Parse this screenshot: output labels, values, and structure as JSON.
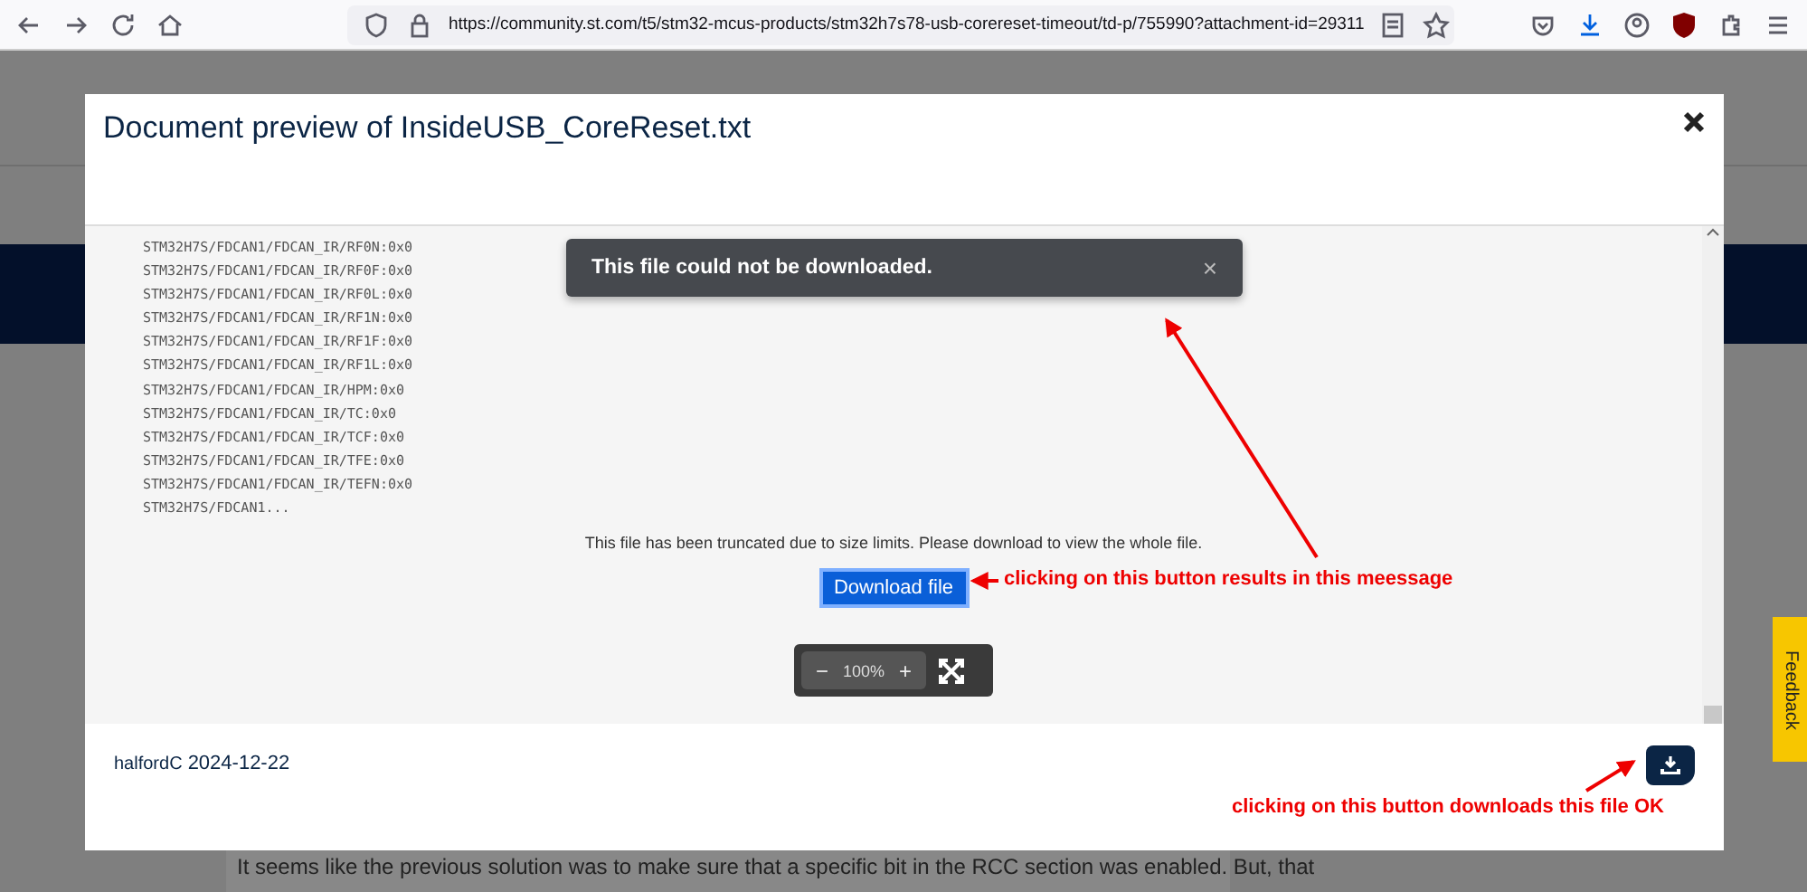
{
  "browser": {
    "url": "https://community.st.com/t5/stm32-mcus-products/stm32h7s78-usb-corereset-timeout/td-p/755990?attachment-id=29311"
  },
  "page": {
    "article_text": "It seems like the previous solution was to make sure that a specific bit in the RCC section was enabled. But, that",
    "feedback_label": "Feedback"
  },
  "modal": {
    "title": "Document preview of InsideUSB_CoreReset.txt",
    "code_lines": [
      "STM32H7S/FDCAN1/FDCAN_IR/RF0N:0x0",
      "STM32H7S/FDCAN1/FDCAN_IR/RF0F:0x0",
      "STM32H7S/FDCAN1/FDCAN_IR/RF0L:0x0",
      "STM32H7S/FDCAN1/FDCAN_IR/RF1N:0x0",
      "STM32H7S/FDCAN1/FDCAN_IR/RF1F:0x0",
      "STM32H7S/FDCAN1/FDCAN_IR/RF1L:0x0",
      "STM32H7S/FDCAN1/FDCAN_IR/HPM:0x0",
      "STM32H7S/FDCAN1/FDCAN_IR/TC:0x0",
      "STM32H7S/FDCAN1/FDCAN_IR/TCF:0x0",
      "STM32H7S/FDCAN1/FDCAN_IR/TFE:0x0",
      "STM32H7S/FDCAN1/FDCAN_IR/TEFN:0x0",
      "STM32H7S/FDCAN1..."
    ],
    "toast": {
      "message": "This file could not be downloaded.",
      "close": "×"
    },
    "notice": "This file has been truncated due to size limits. Please download to view the whole file.",
    "download_button": "Download file",
    "zoom": {
      "minus": "−",
      "reading": "100%",
      "plus": "+"
    },
    "author": "halfordC",
    "date": "2024-12-22"
  },
  "annotations": [
    {
      "text": "clicking on this button results in this meessage"
    },
    {
      "text": "clicking on this button downloads this file OK"
    }
  ]
}
